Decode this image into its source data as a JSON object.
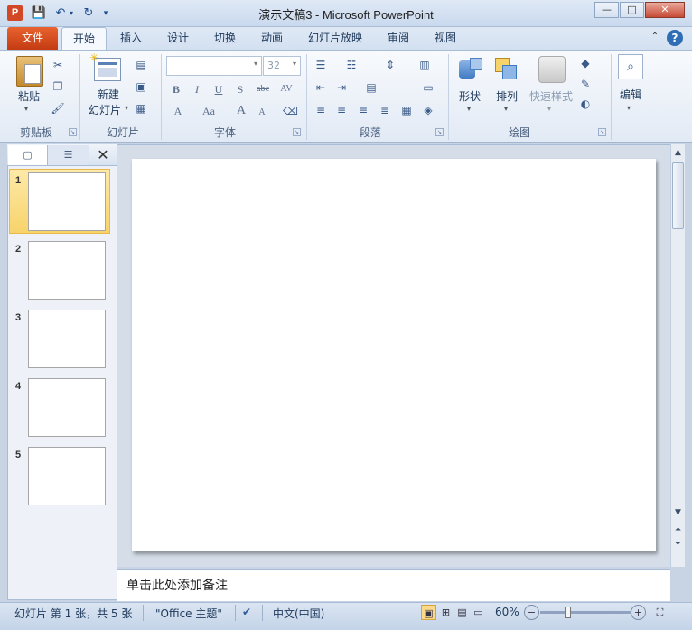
{
  "window": {
    "title": "演示文稿3 - Microsoft PowerPoint",
    "app_icon_letter": "P",
    "controls": {
      "minimize": "—",
      "maximize": "□",
      "close": "✕"
    }
  },
  "quick_access": {
    "save_icon": "save-icon",
    "undo_icon": "undo-icon",
    "redo_icon": "redo-icon",
    "customize_icon": "customize-qat-icon"
  },
  "tabs": [
    {
      "label": "文件"
    },
    {
      "label": "开始",
      "active": true
    },
    {
      "label": "插入"
    },
    {
      "label": "设计"
    },
    {
      "label": "切换"
    },
    {
      "label": "动画"
    },
    {
      "label": "幻灯片放映"
    },
    {
      "label": "审阅"
    },
    {
      "label": "视图"
    }
  ],
  "ribbon": {
    "clipboard": {
      "label": "剪贴板",
      "paste": "粘贴"
    },
    "slides": {
      "label": "幻灯片",
      "new_slide_line1": "新建",
      "new_slide_line2": "幻灯片"
    },
    "font": {
      "label": "字体",
      "font_name": "",
      "font_size": "32",
      "buttons": {
        "bold": "B",
        "italic": "I",
        "underline": "U",
        "shadow": "S",
        "strike": "abc",
        "spacing": "AV",
        "color": "A",
        "case": "Aa",
        "grow": "A",
        "shrink": "A"
      }
    },
    "paragraph": {
      "label": "段落"
    },
    "drawing": {
      "label": "绘图",
      "shapes": "形状",
      "arrange": "排列",
      "quick_styles": "快速样式"
    },
    "editing": {
      "label": "编辑"
    }
  },
  "slides_panel": {
    "thumbnails": [
      {
        "number": "1"
      },
      {
        "number": "2"
      },
      {
        "number": "3"
      },
      {
        "number": "4"
      },
      {
        "number": "5"
      }
    ]
  },
  "notes": {
    "placeholder": "单击此处添加备注"
  },
  "status": {
    "slide_info": "幻灯片 第 1 张，共 5 张",
    "theme": "\"Office 主题\"",
    "language": "中文(中国)",
    "zoom": "60%",
    "zoom_out": "−",
    "zoom_in": "+"
  }
}
